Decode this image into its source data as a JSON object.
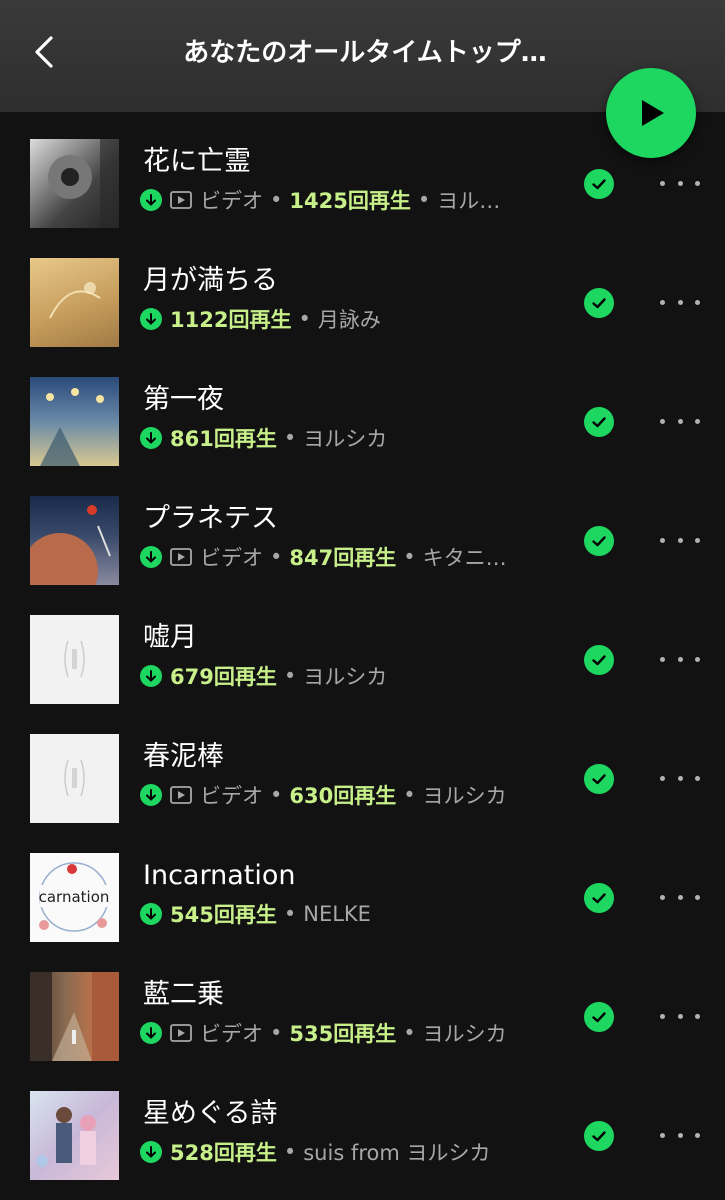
{
  "header": {
    "title": "あなたのオールタイムトップ…",
    "back_icon": "chevron-left-icon",
    "play_icon": "play-icon",
    "accent": "#1ed760"
  },
  "meta": {
    "video_label": "ビデオ",
    "separator": "•",
    "download_icon": "download-icon",
    "video_icon": "video-icon",
    "downloaded_icon": "check-circle-icon",
    "more_icon": "more-horizontal-icon"
  },
  "tracks": [
    {
      "title": "花に亡霊",
      "video": true,
      "plays": "1425回再生",
      "artist": "ヨル…"
    },
    {
      "title": "月が満ちる",
      "video": false,
      "plays": "1122回再生",
      "artist": "月詠み"
    },
    {
      "title": "第一夜",
      "video": false,
      "plays": "861回再生",
      "artist": "ヨルシカ"
    },
    {
      "title": "プラネテス",
      "video": true,
      "plays": "847回再生",
      "artist": "キタニ…"
    },
    {
      "title": "嘘月",
      "video": false,
      "plays": "679回再生",
      "artist": "ヨルシカ"
    },
    {
      "title": "春泥棒",
      "video": true,
      "plays": "630回再生",
      "artist": "ヨルシカ"
    },
    {
      "title": "Incarnation",
      "video": false,
      "plays": "545回再生",
      "artist": "NELKE"
    },
    {
      "title": "藍二乗",
      "video": true,
      "plays": "535回再生",
      "artist": "ヨルシカ"
    },
    {
      "title": "星めぐる詩",
      "video": false,
      "plays": "528回再生",
      "artist": "suis from ヨルシカ"
    }
  ]
}
